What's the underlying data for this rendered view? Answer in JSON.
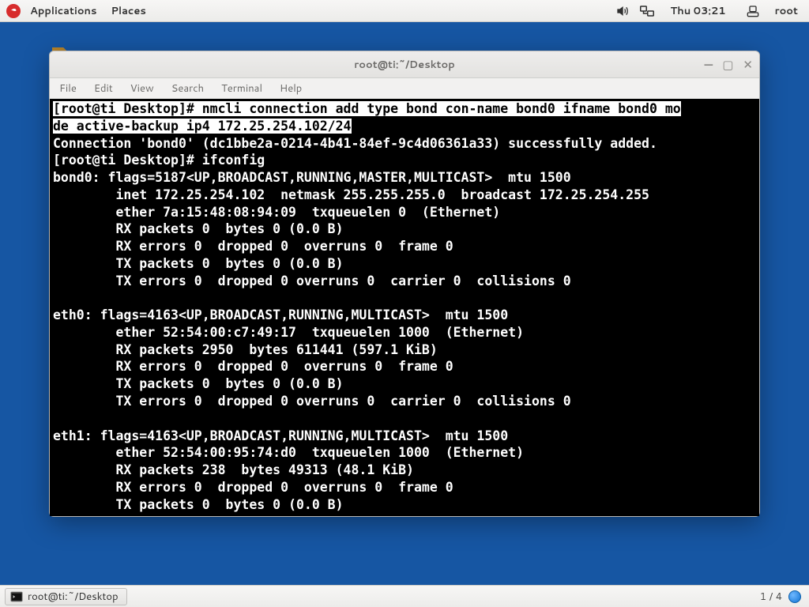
{
  "topbar": {
    "applications": "Applications",
    "places": "Places",
    "clock": "Thu 03:21",
    "user": "root"
  },
  "window": {
    "title": "root@ti:~/Desktop",
    "menus": [
      "File",
      "Edit",
      "View",
      "Search",
      "Terminal",
      "Help"
    ]
  },
  "terminal": {
    "prompt1_inv": "[root@ti Desktop]# ",
    "cmd1_inv_part1": "nmcli connection add type bond con-name bond0 ifname bond0 mo",
    "cmd1_inv_part2": "de active-backup ip4 172.25.254.102/24",
    "resp_added": "Connection 'bond0' (dc1bbe2a-0214-4b41-84ef-9c4d06361a33) successfully added.",
    "prompt2": "[root@ti Desktop]# ifconfig",
    "bond0_l1": "bond0: flags=5187<UP,BROADCAST,RUNNING,MASTER,MULTICAST>  mtu 1500",
    "bond0_l2": "        inet 172.25.254.102  netmask 255.255.255.0  broadcast 172.25.254.255",
    "bond0_l3": "        ether 7a:15:48:08:94:09  txqueuelen 0  (Ethernet)",
    "bond0_l4": "        RX packets 0  bytes 0 (0.0 B)",
    "bond0_l5": "        RX errors 0  dropped 0  overruns 0  frame 0",
    "bond0_l6": "        TX packets 0  bytes 0 (0.0 B)",
    "bond0_l7": "        TX errors 0  dropped 0 overruns 0  carrier 0  collisions 0",
    "blank1": "",
    "eth0_l1": "eth0: flags=4163<UP,BROADCAST,RUNNING,MULTICAST>  mtu 1500",
    "eth0_l2": "        ether 52:54:00:c7:49:17  txqueuelen 1000  (Ethernet)",
    "eth0_l3": "        RX packets 2950  bytes 611441 (597.1 KiB)",
    "eth0_l4": "        RX errors 0  dropped 0  overruns 0  frame 0",
    "eth0_l5": "        TX packets 0  bytes 0 (0.0 B)",
    "eth0_l6": "        TX errors 0  dropped 0 overruns 0  carrier 0  collisions 0",
    "blank2": "",
    "eth1_l1": "eth1: flags=4163<UP,BROADCAST,RUNNING,MULTICAST>  mtu 1500",
    "eth1_l2": "        ether 52:54:00:95:74:d0  txqueuelen 1000  (Ethernet)",
    "eth1_l3": "        RX packets 238  bytes 49313 (48.1 KiB)",
    "eth1_l4": "        RX errors 0  dropped 0  overruns 0  frame 0",
    "eth1_l5": "        TX packets 0  bytes 0 (0.0 B)"
  },
  "taskbar": {
    "task_label": "root@ti:~/Desktop",
    "workspace": "1 / 4"
  }
}
